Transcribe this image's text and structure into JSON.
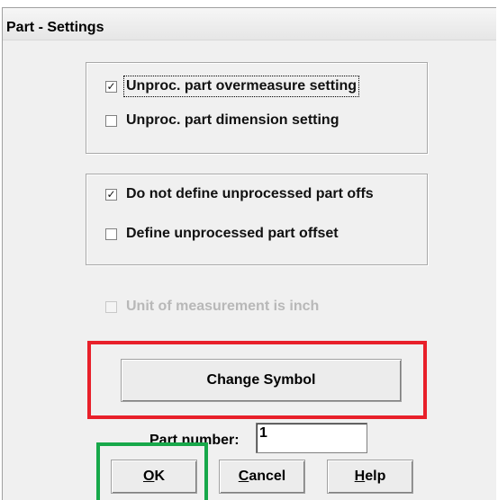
{
  "window": {
    "title": "Part - Settings"
  },
  "group_overmeasure": {
    "items": [
      {
        "label": "Unproc. part overmeasure setting",
        "checked": true,
        "check_glyph": "✓"
      },
      {
        "label": "Unproc. part dimension setting",
        "checked": false,
        "check_glyph": ""
      }
    ]
  },
  "group_offset": {
    "items": [
      {
        "label": "Do not define unprocessed part offs",
        "checked": true,
        "check_glyph": "✓"
      },
      {
        "label": "Define unprocessed part offset",
        "checked": false,
        "check_glyph": ""
      }
    ]
  },
  "unit_inch": {
    "label": "Unit of measurement is inch",
    "checked": false,
    "disabled": true,
    "check_glyph": ""
  },
  "change_symbol": {
    "label": "Change Symbol"
  },
  "part_number": {
    "label": "Part number:",
    "value": "1"
  },
  "buttons": {
    "ok": {
      "mnemonic": "O",
      "rest": "K"
    },
    "cancel": {
      "mnemonic": "C",
      "rest": "ancel"
    },
    "help": {
      "mnemonic": "H",
      "rest": "elp"
    }
  },
  "highlights": {
    "red": "#e8202a",
    "green": "#17a84a"
  }
}
